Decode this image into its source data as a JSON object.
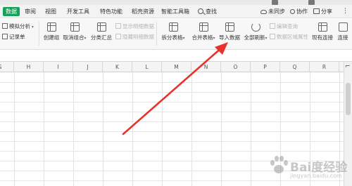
{
  "menu": {
    "tabs": [
      "数据",
      "审阅",
      "视图",
      "开发工具",
      "特色功能",
      "稻壳资源",
      "智能工具箱"
    ],
    "active_tab": "数据",
    "search_label": "查找",
    "unsynced": "未同步",
    "collaborate": "协作",
    "share": "分享",
    "more": "⋮"
  },
  "ribbon": {
    "simulate_analysis": "模拟分析",
    "record_form": "记录单",
    "create_group": "创建组",
    "ungroup": "取消组合",
    "subtotal": "分类汇总",
    "show_detail": "显示明细数据",
    "hide_detail": "隐藏明细数据",
    "split_table": "拆分表格",
    "merge_table": "合并表格",
    "import_data": "导入数据",
    "refresh_all": "全部刷新",
    "edit_link": "编辑查询",
    "data_range_props": "数据区域属性",
    "existing_links": "现有连接",
    "links": "连接"
  },
  "sheet": {
    "columns": [
      "G",
      "H",
      "I",
      "J",
      "K",
      "L",
      "M",
      "N",
      "O",
      "P",
      "Q",
      "R"
    ]
  },
  "watermark": {
    "text": "Bai度经验",
    "sub": "jingyan.baidu.com"
  },
  "colors": {
    "accent": "#18a05a",
    "arrow": "#e8322c"
  }
}
